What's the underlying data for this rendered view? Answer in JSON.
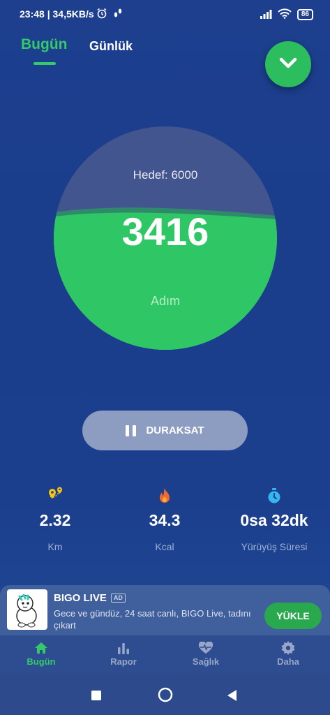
{
  "status_bar": {
    "time": "23:48 | 34,5KB/s",
    "battery": "86"
  },
  "tabs": {
    "today": "Bugün",
    "daily": "Günlük"
  },
  "progress": {
    "goal_label": "Hedef: 6000",
    "steps": "3416",
    "unit": "Adım",
    "fill_fraction": 0.569
  },
  "pause_button": {
    "label": "DURAKSAT"
  },
  "stats": [
    {
      "icon": "location-pins-icon",
      "value": "2.32",
      "label": "Km"
    },
    {
      "icon": "flame-icon",
      "value": "34.3",
      "label": "Kcal"
    },
    {
      "icon": "stopwatch-icon",
      "value": "0sa 32dk",
      "label": "Yürüyüş Süresi"
    }
  ],
  "ad": {
    "title": "BIGO LIVE",
    "badge": "AD",
    "description": "Gece ve gündüz, 24 saat canlı, BIGO Live, tadını çıkart",
    "button": "YÜKLE"
  },
  "bottom_nav": [
    {
      "icon": "home-icon",
      "label": "Bugün",
      "active": true
    },
    {
      "icon": "bar-chart-icon",
      "label": "Rapor",
      "active": false
    },
    {
      "icon": "heart-pulse-icon",
      "label": "Sağlık",
      "active": false
    },
    {
      "icon": "gear-icon",
      "label": "Daha",
      "active": false
    }
  ],
  "colors": {
    "accent": "#34c96a",
    "background": "#1d3f8e",
    "button": "#8d9dc1"
  }
}
